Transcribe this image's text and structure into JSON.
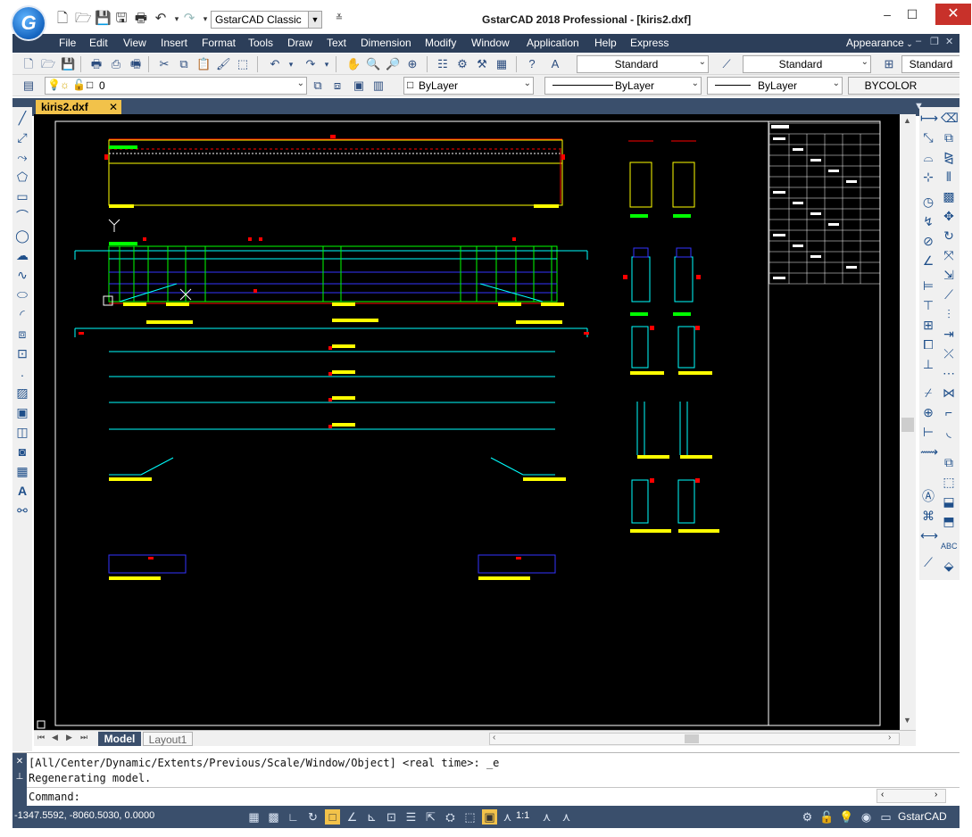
{
  "titlebar": {
    "logo_letter": "G",
    "workspace": "GstarCAD Classic",
    "title": "GstarCAD 2018 Professional - [kiris2.dxf]",
    "minimize": "–",
    "maximize": "☐",
    "close": "✕"
  },
  "menu": {
    "items": [
      "File",
      "Edit",
      "View",
      "Insert",
      "Format",
      "Tools",
      "Draw",
      "Text",
      "Dimension",
      "Modify",
      "Window",
      "Application",
      "Help",
      "Express"
    ],
    "appearance": "Appearance",
    "mdi_min": "–",
    "mdi_restore": "❐",
    "mdi_close": "✕"
  },
  "toolbar2": {
    "text_style": "Standard",
    "dim_style": "Standard",
    "table_style": "Standard"
  },
  "toolbar3": {
    "layer": "0",
    "color": "ByLayer",
    "linetype": "ByLayer",
    "lineweight": "ByLayer",
    "plotstyle": "BYCOLOR"
  },
  "document_tab": {
    "name": "kiris2.dxf",
    "close": "✕"
  },
  "layout_tabs": {
    "model": "Model",
    "layout1": "Layout1"
  },
  "command": {
    "line1": "[All/Center/Dynamic/Extents/Previous/Scale/Window/Object] <real time>: _e",
    "line2": "Regenerating model.",
    "prompt": "Command:"
  },
  "status": {
    "coords": "-1347.5592, -8060.5030, 0.0000",
    "scale": "1:1",
    "app": "GstarCAD"
  },
  "colors": {
    "menubar": "#2c3e59",
    "tab_active": "#f2c24a",
    "canvas": "#000000",
    "cad_red": "#ff0000",
    "cad_yellow": "#ffff00",
    "cad_green": "#00ff00",
    "cad_cyan": "#00ffff",
    "cad_blue": "#0000ff"
  }
}
